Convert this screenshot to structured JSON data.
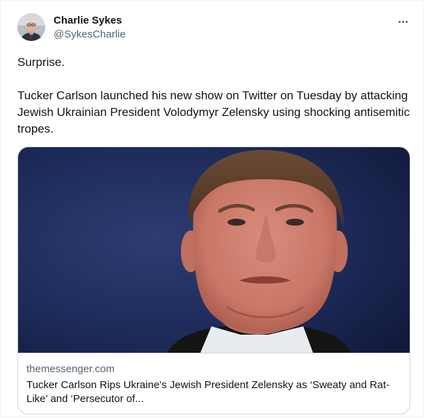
{
  "author": {
    "display_name": "Charlie Sykes",
    "handle": "@SykesCharlie",
    "avatar_icon": "profile-photo"
  },
  "more_icon": "ellipsis-icon",
  "tweet": {
    "line_1": "Surprise.",
    "line_2": "Tucker Carlson launched his new show on Twitter on Tuesday by attacking Jewish Ukrainian President Volodymyr Zelensky using shocking antisemitic tropes."
  },
  "link_card": {
    "domain": "themessenger.com",
    "title": "Tucker Carlson Rips Ukraine’s Jewish President Zelensky as ‘Sweaty and Rat-Like’ and ‘Persecutor of..."
  },
  "colors": {
    "text_primary": "#0f1419",
    "text_secondary": "#536471",
    "border": "#cfd9de",
    "image_background": "#22305f"
  }
}
